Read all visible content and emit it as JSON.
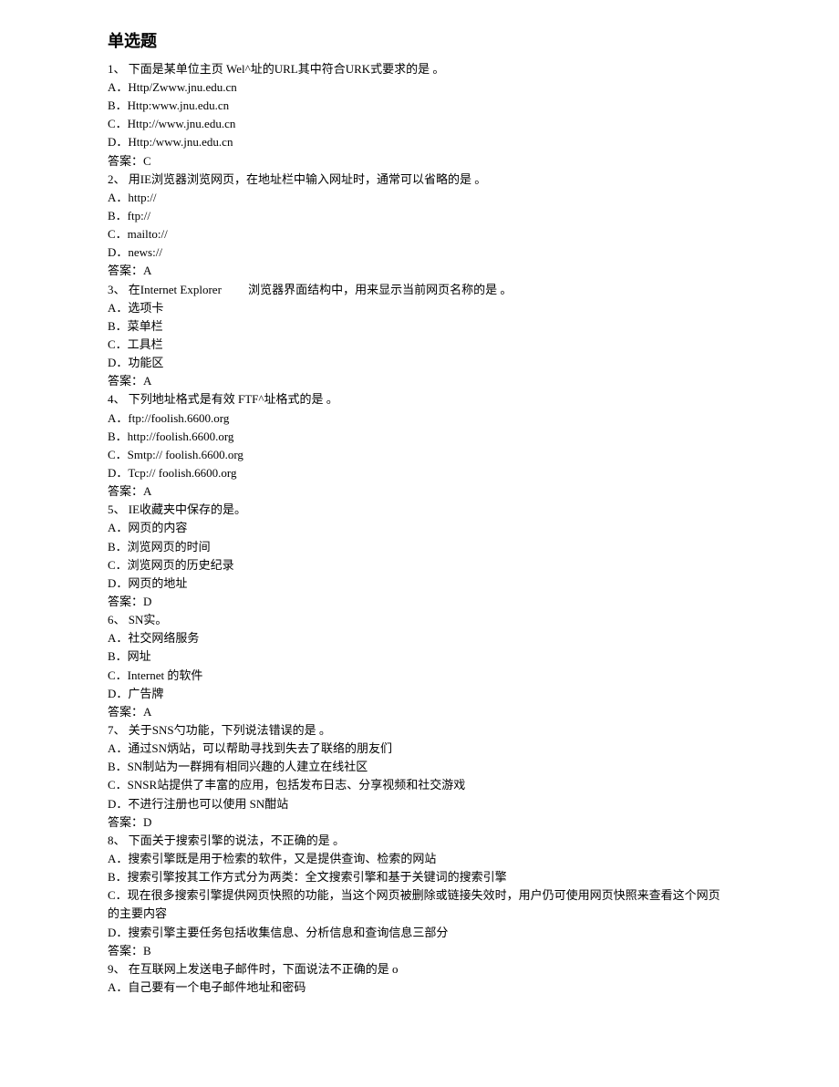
{
  "title": "单选题",
  "questions": [
    {
      "stem": "1、 下面是某单位主页 Wel^址的URL其中符合URK式要求的是 。",
      "options": [
        "A．Http/Zwww.jnu.edu.cn",
        "B．Http:www.jnu.edu.cn",
        "C．Http://www.jnu.edu.cn",
        "D．Http:/www.jnu.edu.cn"
      ],
      "answer": "答案：C"
    },
    {
      "stem": "2、 用IE浏览器浏览网页，在地址栏中输入网址时，通常可以省略的是 。",
      "options": [
        "A．http://",
        "B．ftp://",
        "C．mailto://",
        "D．news://"
      ],
      "answer": "答案：A"
    },
    {
      "stem": "3、 在Internet Explorer         浏览器界面结构中，用来显示当前网页名称的是 。",
      "options": [
        "A．选项卡",
        "B．菜单栏",
        "C．工具栏",
        "D．功能区"
      ],
      "answer": "答案：A"
    },
    {
      "stem": "4、 下列地址格式是有效 FTF^址格式的是 。",
      "options": [
        "A．ftp://foolish.6600.org",
        "B．http://foolish.6600.org",
        "C．Smtp:// foolish.6600.org",
        "D．Tcp:// foolish.6600.org"
      ],
      "answer": "答案：A"
    },
    {
      "stem": "5、 IE收藏夹中保存的是。",
      "options": [
        "A．网页的内容",
        "B．浏览网页的时间",
        "C．浏览网页的历史纪录",
        "D．网页的地址"
      ],
      "answer": "答案：D"
    },
    {
      "stem": "6、 SN实。",
      "options": [
        "A．社交网络服务",
        "B．网址",
        "C．Internet 的软件",
        "D．广告牌"
      ],
      "answer": "答案：A"
    },
    {
      "stem": "7、 关于SNS勺功能，下列说法错误的是 。",
      "options": [
        "A．通过SN炳站，可以帮助寻找到失去了联络的朋友们",
        "B．SN制站为一群拥有相同兴趣的人建立在线社区",
        "C．SNSR站提供了丰富的应用，包括发布日志、分享视频和社交游戏",
        "D．不进行注册也可以使用 SN酣站"
      ],
      "answer": "答案：D"
    },
    {
      "stem": "8、 下面关于搜索引擎的说法，不正确的是 。",
      "options": [
        "A．搜索引擎既是用于检索的软件，又是提供查询、检索的网站",
        "B．搜索引擎按其工作方式分为两类：全文搜索引擎和基于关键词的搜索引擎",
        "C．现在很多搜索引擎提供网页快照的功能，当这个网页被删除或链接失效时，用户仍可使用网页快照来查看这个网页的主要内容",
        "D．搜索引擎主要任务包括收集信息、分析信息和查询信息三部分"
      ],
      "answer": "答案：B"
    },
    {
      "stem": "9、 在互联网上发送电子邮件时，下面说法不正确的是 o",
      "options": [
        "A．自己要有一个电子邮件地址和密码"
      ],
      "answer": ""
    }
  ]
}
